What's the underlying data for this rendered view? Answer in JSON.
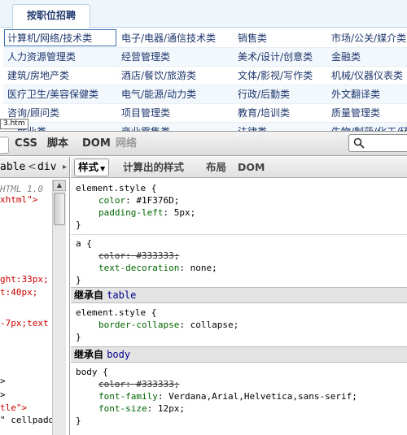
{
  "web": {
    "tab_label": "按职位招聘",
    "status_tip": "3.htm",
    "rows": [
      [
        "计算机/网络/技术类",
        "电子/电器/通信技术类",
        "销售类",
        "市场/公关/媒介类"
      ],
      [
        "人力资源管理类",
        "经营管理类",
        "美术/设计/创意类",
        "金融类"
      ],
      [
        "建筑/房地产类",
        "酒店/餐饮/旅游类",
        "文体/影视/写作类",
        "机械/仪器仪表类"
      ],
      [
        "医疗卫生/美容保健类",
        "电气/能源/动力类",
        "行政/后勤类",
        "外文翻译类"
      ],
      [
        "咨询/顾问类",
        "项目管理类",
        "教育/培训类",
        "质量管理类"
      ],
      [
        "…就业类",
        "商业零售类",
        "法律类",
        "生物/制药/化工/环"
      ]
    ]
  },
  "firebug": {
    "tabs": {
      "css": "CSS",
      "script": "脚本",
      "dom": "DOM",
      "net": "网络"
    },
    "crumbs": {
      "table": "able",
      "nav": "<",
      "div": "div"
    },
    "html_lines": [
      {
        "text": "HTML 1.0",
        "style": "grey"
      },
      {
        "text": "xhtml\">",
        "style": "red"
      },
      {
        "text": "ght:33px;",
        "style": "red"
      },
      {
        "text": "t:40px;",
        "style": "red"
      },
      {
        "text": "-7px;text",
        "style": "red"
      },
      {
        "text": ">",
        "style": "dark"
      },
      {
        "text": ">",
        "style": "dark"
      },
      {
        "text": "tle\">",
        "style": "red"
      },
      {
        "text": "\" cellpadd",
        "style": "dark"
      }
    ],
    "side_tabs": {
      "style": "样式",
      "computed": "计算出的样式",
      "layout": "布局",
      "dom": "DOM"
    },
    "css_rules": {
      "r1": {
        "selector": "element.style {",
        "p1_name": "color",
        "p1_val": "#1F376D;",
        "p2_name": "padding-left",
        "p2_val": "5px;",
        "close": "}"
      },
      "r2": {
        "selector": "a {",
        "p1_name": "color",
        "p1_val": "#333333;",
        "p2_name": "text-decoration",
        "p2_val": "none;",
        "close": "}"
      },
      "inherit1": {
        "label": "继承自",
        "element": "table"
      },
      "r3": {
        "selector": "element.style {",
        "p1_name": "border-collapse",
        "p1_val": "collapse;",
        "close": "}"
      },
      "inherit2": {
        "label": "继承自",
        "element": "body"
      },
      "r4": {
        "selector": "body {",
        "p1_name": "color",
        "p1_val": "#333333;",
        "p2_name": "font-family",
        "p2_val": "Verdana,Arial,Helvetica,sans-serif;",
        "p3_name": "font-size",
        "p3_val": "12px;",
        "close": "}"
      }
    }
  },
  "colors": {
    "link": "#1F376D",
    "tab_bar": "#eef5fb",
    "firebug_toolbar": "#dcdcdc",
    "code_red": "#cc0000"
  },
  "icons": [
    "search-icon",
    "dropdown-caret-icon",
    "breadcrumb-chevron-icon"
  ]
}
